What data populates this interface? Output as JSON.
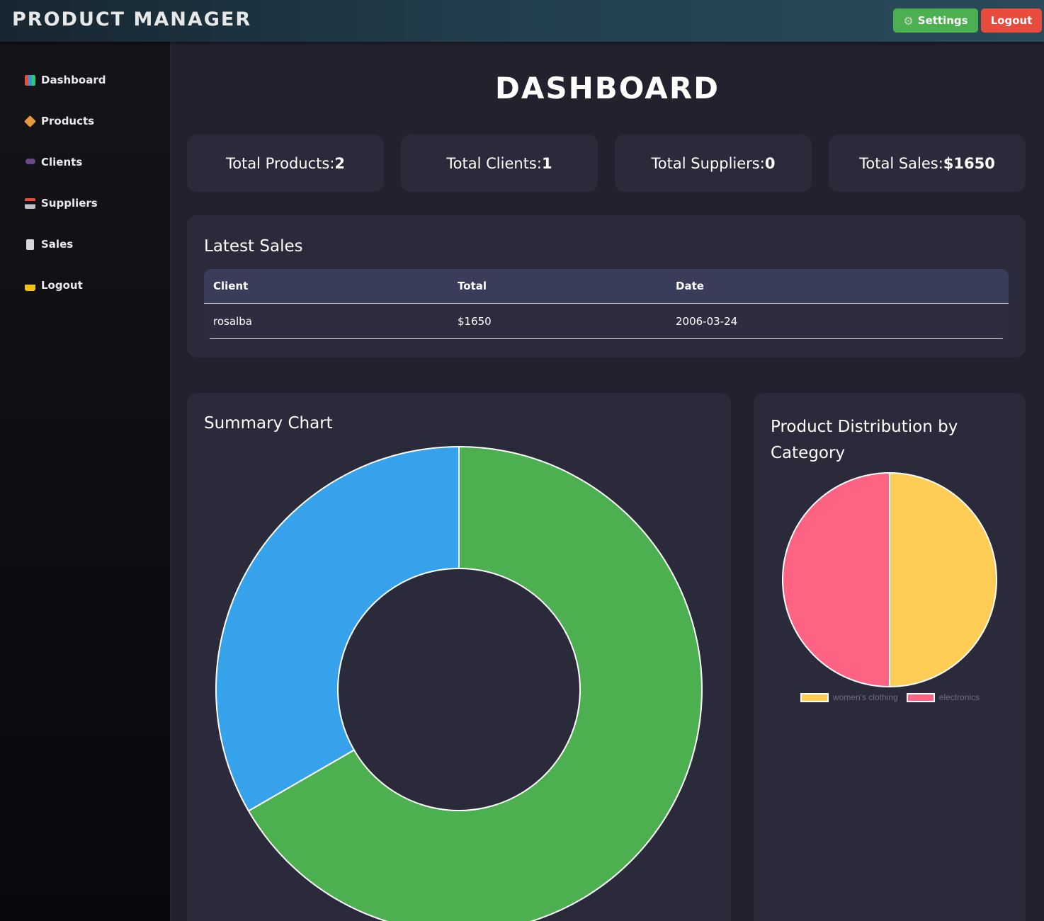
{
  "app": {
    "title": "PRODUCT MANAGER",
    "settings_label": "Settings",
    "logout_label": "Logout"
  },
  "sidebar": {
    "items": [
      {
        "label": "Dashboard",
        "icon": "bar-chart-icon"
      },
      {
        "label": "Products",
        "icon": "package-icon"
      },
      {
        "label": "Clients",
        "icon": "users-icon"
      },
      {
        "label": "Suppliers",
        "icon": "factory-icon"
      },
      {
        "label": "Sales",
        "icon": "receipt-icon"
      },
      {
        "label": "Logout",
        "icon": "lock-icon"
      }
    ]
  },
  "page": {
    "title": "DASHBOARD"
  },
  "stats": [
    {
      "label": "Total Products:",
      "value": "2"
    },
    {
      "label": "Total Clients:",
      "value": "1"
    },
    {
      "label": "Total Suppliers:",
      "value": "0"
    },
    {
      "label": "Total Sales:",
      "value": "$1650"
    }
  ],
  "latest_sales": {
    "title": "Latest Sales",
    "columns": [
      "Client",
      "Total",
      "Date"
    ],
    "rows": [
      {
        "client": "rosalba",
        "total": "$1650",
        "date": "2006-03-24"
      }
    ]
  },
  "summary_chart": {
    "title": "Summary Chart"
  },
  "category_chart": {
    "title_line1": "Product Distribution by",
    "title_line2": "Category"
  },
  "chart_data": [
    {
      "type": "pie",
      "variant": "doughnut",
      "title": "Summary Chart",
      "categories": [
        "",
        "",
        ""
      ],
      "values": [
        2,
        1,
        0
      ],
      "colors": [
        "#4caf50",
        "#36a2eb",
        "#ffcd56"
      ]
    },
    {
      "type": "pie",
      "title": "Product Distribution by Category",
      "categories": [
        "women's clothing",
        "electronics"
      ],
      "values": [
        1,
        1
      ],
      "colors": [
        "#ffcd56",
        "#ff6384"
      ],
      "legend": "bottom"
    }
  ],
  "colors": {
    "settings_button": "#4caf50",
    "logout_button": "#e74c3c",
    "card_background": "#2b2a3a",
    "page_background": "#22222f"
  }
}
